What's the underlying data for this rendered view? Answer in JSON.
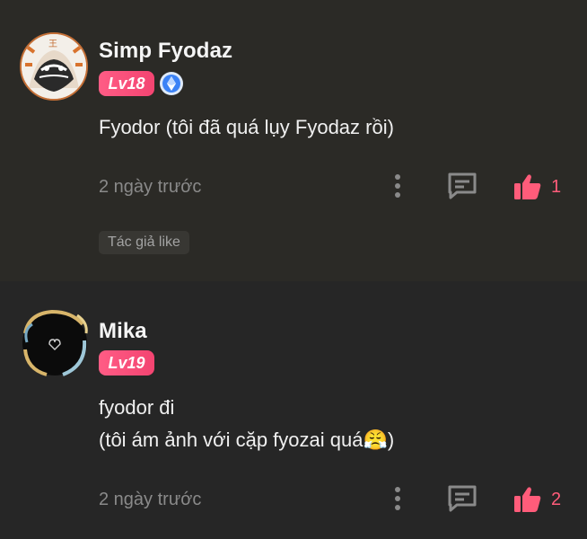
{
  "comments": [
    {
      "username": "Simp Fyodaz",
      "level": "Lv18",
      "rank_icon": "diamond-badge-icon",
      "content_lines": [
        "Fyodor (tôi đã quá lụy Fyodaz rồi)"
      ],
      "timestamp": "2 ngày trước",
      "likes": "1",
      "author_like_label": "Tác giả like",
      "avatar_text": "王"
    },
    {
      "username": "Mika",
      "level": "Lv19",
      "content_lines": [
        "fyodor đi",
        "(tôi ám ảnh với cặp fyozai quá😤)"
      ],
      "timestamp": "2 ngày trước",
      "likes": "2"
    }
  ],
  "colors": {
    "accent": "#ff5c7a",
    "badge": "#f34471",
    "background_1": "#2b2a26",
    "background_2": "#262626"
  }
}
